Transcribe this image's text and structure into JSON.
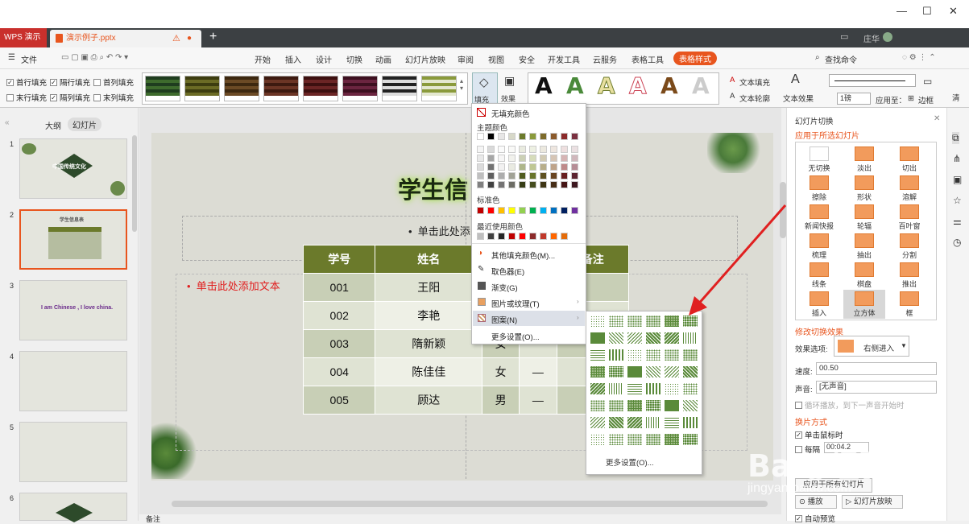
{
  "app": {
    "name": "WPS 演示",
    "doc_tab": "演示例子.pptx",
    "user": "庄华"
  },
  "menu": {
    "items": [
      "开始",
      "插入",
      "设计",
      "切换",
      "动画",
      "幻灯片放映",
      "审阅",
      "视图",
      "安全",
      "开发工具",
      "云服务",
      "表格工具"
    ],
    "active": "表格样式",
    "file": "文件",
    "search": "查找命令"
  },
  "ribbon": {
    "checks": [
      {
        "label": "首行填充",
        "checked": true
      },
      {
        "label": "隔行填充",
        "checked": true
      },
      {
        "label": "首列填充",
        "checked": false
      },
      {
        "label": "末行填充",
        "checked": false
      },
      {
        "label": "隔列填充",
        "checked": true
      },
      {
        "label": "末列填充",
        "checked": false
      }
    ],
    "fill_label": "填充",
    "effect_label": "效果",
    "text_fill": "文本填充",
    "text_outline": "文本轮廓",
    "text_effect": "文本效果",
    "line_weight": "1磅",
    "apply_to": "应用至：",
    "border": "边框",
    "clear": "清"
  },
  "left_panel": {
    "tabs": [
      "大纲",
      "幻灯片"
    ],
    "active_tab": "幻灯片",
    "slides": [
      "1",
      "2",
      "3",
      "4",
      "5",
      "6"
    ],
    "slide1_title": "中国传统文化",
    "slide2_title": "学生信息表",
    "slide3_text": "I am Chinese , I love china."
  },
  "slide": {
    "title": "学生信",
    "subtitle_placeholder": "单击此处添",
    "body_placeholder": "单击此处添加文本",
    "table": {
      "headers": [
        "学号",
        "姓名",
        "性",
        "",
        "备注"
      ],
      "rows": [
        [
          "001",
          "王阳",
          "男",
          "",
          ""
        ],
        [
          "002",
          "李艳",
          "女",
          "",
          ""
        ],
        [
          "003",
          "隋新颖",
          "女",
          "",
          ""
        ],
        [
          "004",
          "陈佳佳",
          "女",
          "—",
          ""
        ],
        [
          "005",
          "顾达",
          "男",
          "—",
          ""
        ]
      ]
    }
  },
  "fill_menu": {
    "no_fill": "无填充颜色",
    "theme_colors": "主题颜色",
    "standard_colors": "标准色",
    "recent_colors": "最近使用颜色",
    "more_fill": "其他填充颜色(M)...",
    "eyedropper": "取色器(E)",
    "gradient": "渐变(G)",
    "picture_texture": "图片或纹理(T)",
    "pattern": "图案(N)",
    "more_settings": "更多设置(O)...",
    "theme_top": [
      "#ffffff",
      "#000000",
      "#e7e6e6",
      "#d7d8c8",
      "#6b7a2b",
      "#8a9a3b",
      "#7d6b2a",
      "#8b5a2b",
      "#8b2a2a",
      "#7a3040"
    ],
    "standard": [
      "#c00000",
      "#ff0000",
      "#ffc000",
      "#ffff00",
      "#92d050",
      "#00b050",
      "#00b0f0",
      "#0070c0",
      "#002060",
      "#7030a0"
    ],
    "recent": [
      "#bfbfbf",
      "#404040",
      "#262626",
      "#c00000",
      "#ff0000",
      "#8b2a2a",
      "#c0392b",
      "#ff6600",
      "#e46c0a"
    ]
  },
  "pattern_menu": {
    "more_settings": "更多设置(O)..."
  },
  "right_panel": {
    "title": "幻灯片切换",
    "apply_selected": "应用于所选幻灯片",
    "transitions": [
      "无切换",
      "淡出",
      "切出",
      "擦除",
      "形状",
      "溶解",
      "新闻快报",
      "轮辐",
      "百叶窗",
      "梳理",
      "抽出",
      "分割",
      "线条",
      "棋盘",
      "推出",
      "插入",
      "立方体",
      "框"
    ],
    "selected": "立方体",
    "modify": "修改切换效果",
    "effect_option_label": "效果选项:",
    "effect_option": "右侧进入",
    "speed_label": "速度:",
    "speed": "00.50",
    "sound_label": "声音:",
    "sound": "[无声音]",
    "loop": "循环播放，到下一声音开始时",
    "advance": "换片方式",
    "on_click": "单击鼠标时",
    "every": "每隔",
    "every_value": "00:04.2",
    "apply_all": "应用于所有幻灯片",
    "play": "播放",
    "slideshow": "幻灯片放映",
    "autopreview": "自动预览"
  },
  "status": {
    "notes": "备注"
  },
  "accent": "#e8551e"
}
